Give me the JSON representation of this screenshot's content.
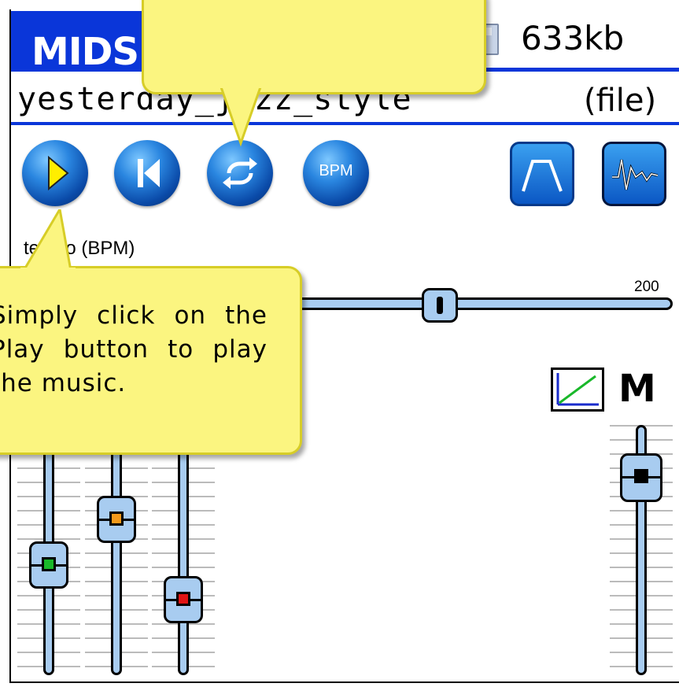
{
  "app": {
    "title": "MIDS",
    "file_size": "633kb",
    "file_name": "yesterday_jazz_style",
    "file_label": "(file)"
  },
  "toolbar": {
    "play_icon": "play-icon",
    "rewind_icon": "rewind-icon",
    "loop_icon": "loop-icon",
    "bpm_label": "BPM",
    "envelope_icon": "envelope-icon",
    "waveform_icon": "waveform-icon"
  },
  "tempo": {
    "label": "tempo (BPM)",
    "max_label": "200",
    "value_fraction": 0.62
  },
  "callout": {
    "text": "Simply click on the Play button to play the music."
  },
  "mixer": {
    "master_label": "M",
    "channels": [
      {
        "color": "#19b82a",
        "level": 0.55
      },
      {
        "color": "#f39a1b",
        "level": 0.7
      },
      {
        "color": "#e11414",
        "level": 0.35
      }
    ],
    "master_level": 0.82
  }
}
